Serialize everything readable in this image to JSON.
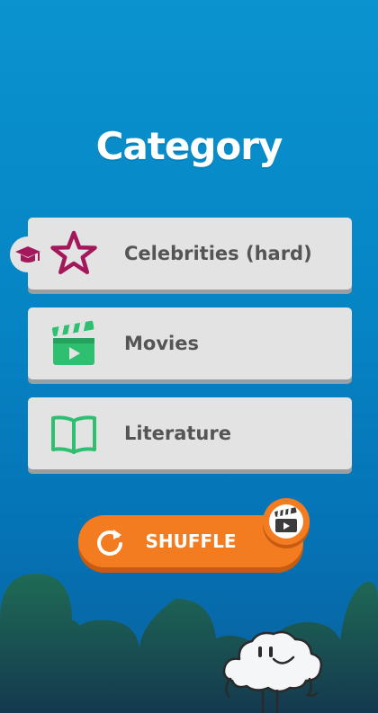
{
  "screen": {
    "title": "Category"
  },
  "categories": [
    {
      "label": "Celebrities (hard)",
      "icon": "star-icon",
      "badge": "graduation-cap-icon",
      "color": "#a3175b"
    },
    {
      "label": "Movies",
      "icon": "clapperboard-icon",
      "color": "#2fbf71"
    },
    {
      "label": "Literature",
      "icon": "open-book-icon",
      "color": "#2fbf71"
    }
  ],
  "shuffle": {
    "label": "SHUFFLE",
    "icon": "refresh-icon",
    "badge_icon": "clapperboard-icon",
    "color": "#f47c20"
  },
  "colors": {
    "background_top": "#0a93cf",
    "background_bottom": "#0a5f9c",
    "hills": "#1e5b58",
    "card": "#e3e3e3",
    "card_text": "#555555"
  }
}
